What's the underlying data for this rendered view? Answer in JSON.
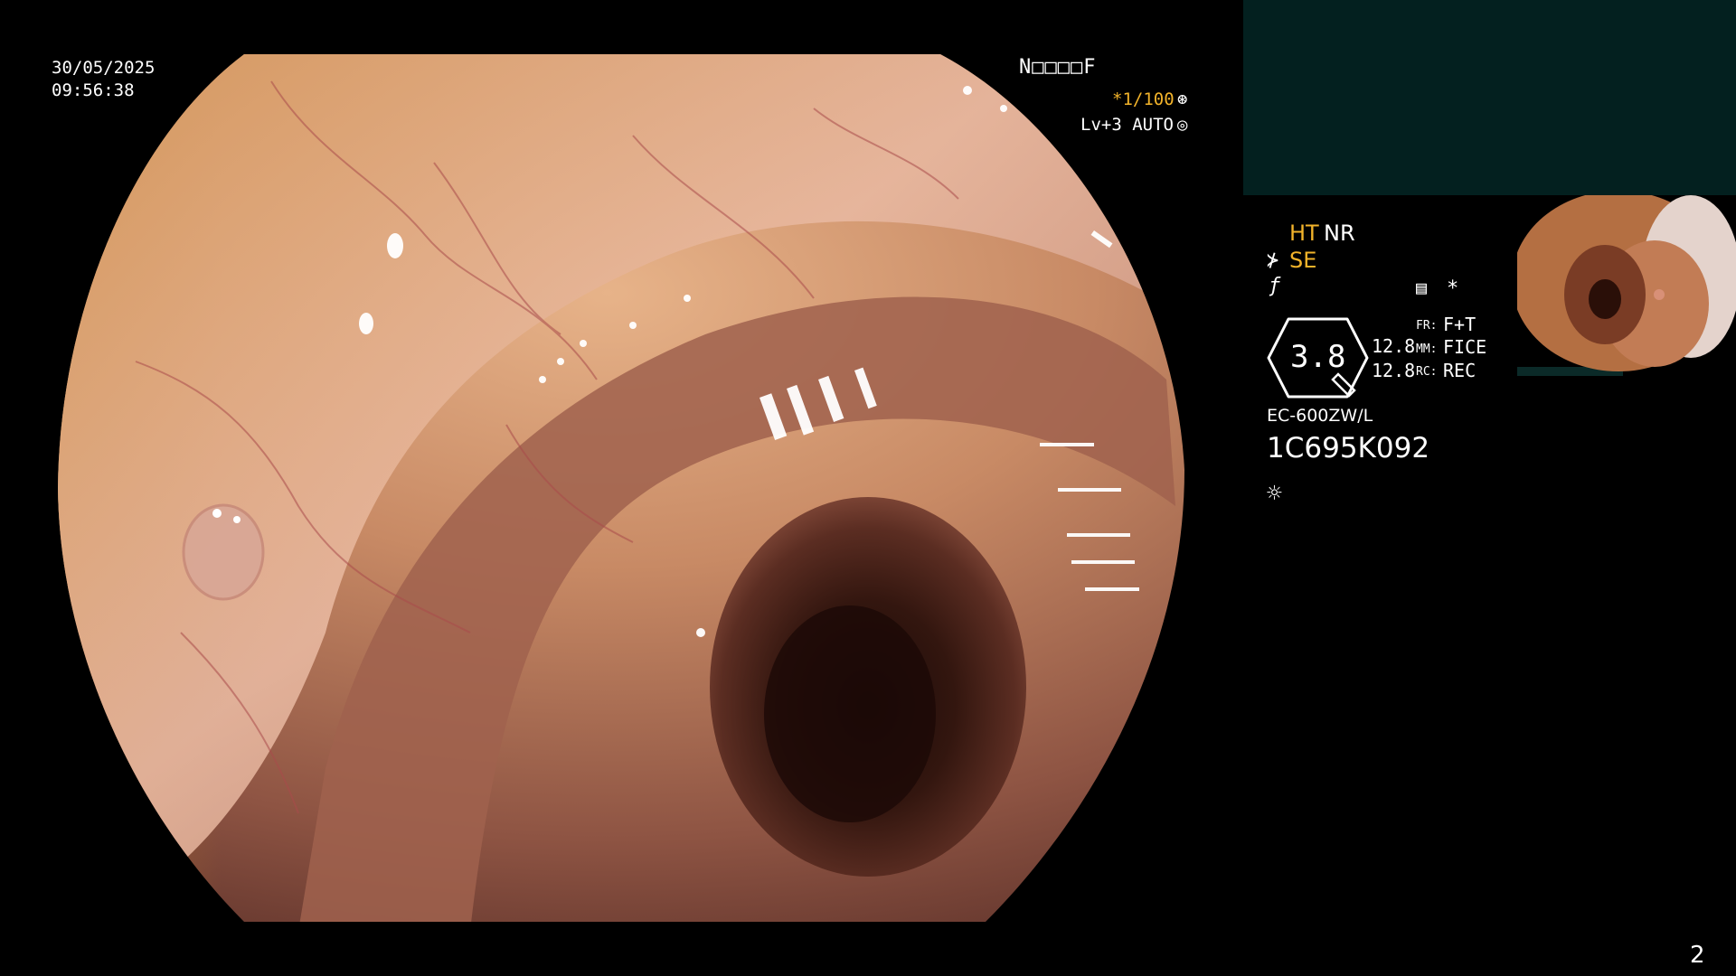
{
  "overlay": {
    "date": "30/05/2025",
    "time": "09:56:38",
    "code": "N□□□□F",
    "shutter": "*1/100",
    "shutter_icon": "aperture-icon",
    "level": "Lv+3 AUTO",
    "level_icon": "target-icon"
  },
  "panel": {
    "ht": "HT",
    "nr": "NR",
    "se": "SE",
    "se_icon": "scope-tip-icon",
    "f_icon": "struck-f-icon",
    "doc_icon": "document-icon",
    "star": "*",
    "hex_value": "3.8",
    "num1": "12.8",
    "num2": "12.8",
    "fr_label": "FR:",
    "fr_value": "F+T",
    "mm_label": "MM:",
    "mm_value": "FICE",
    "rc_label": "RC:",
    "rc_value": "REC",
    "model": "EC-600ZW/L",
    "serial": "1C695K092",
    "sun_icon": "brightness-icon"
  },
  "page_number": "2",
  "colors": {
    "accent_orange": "#f2b32a",
    "panel_teal": "#03201f",
    "background": "#000000"
  }
}
